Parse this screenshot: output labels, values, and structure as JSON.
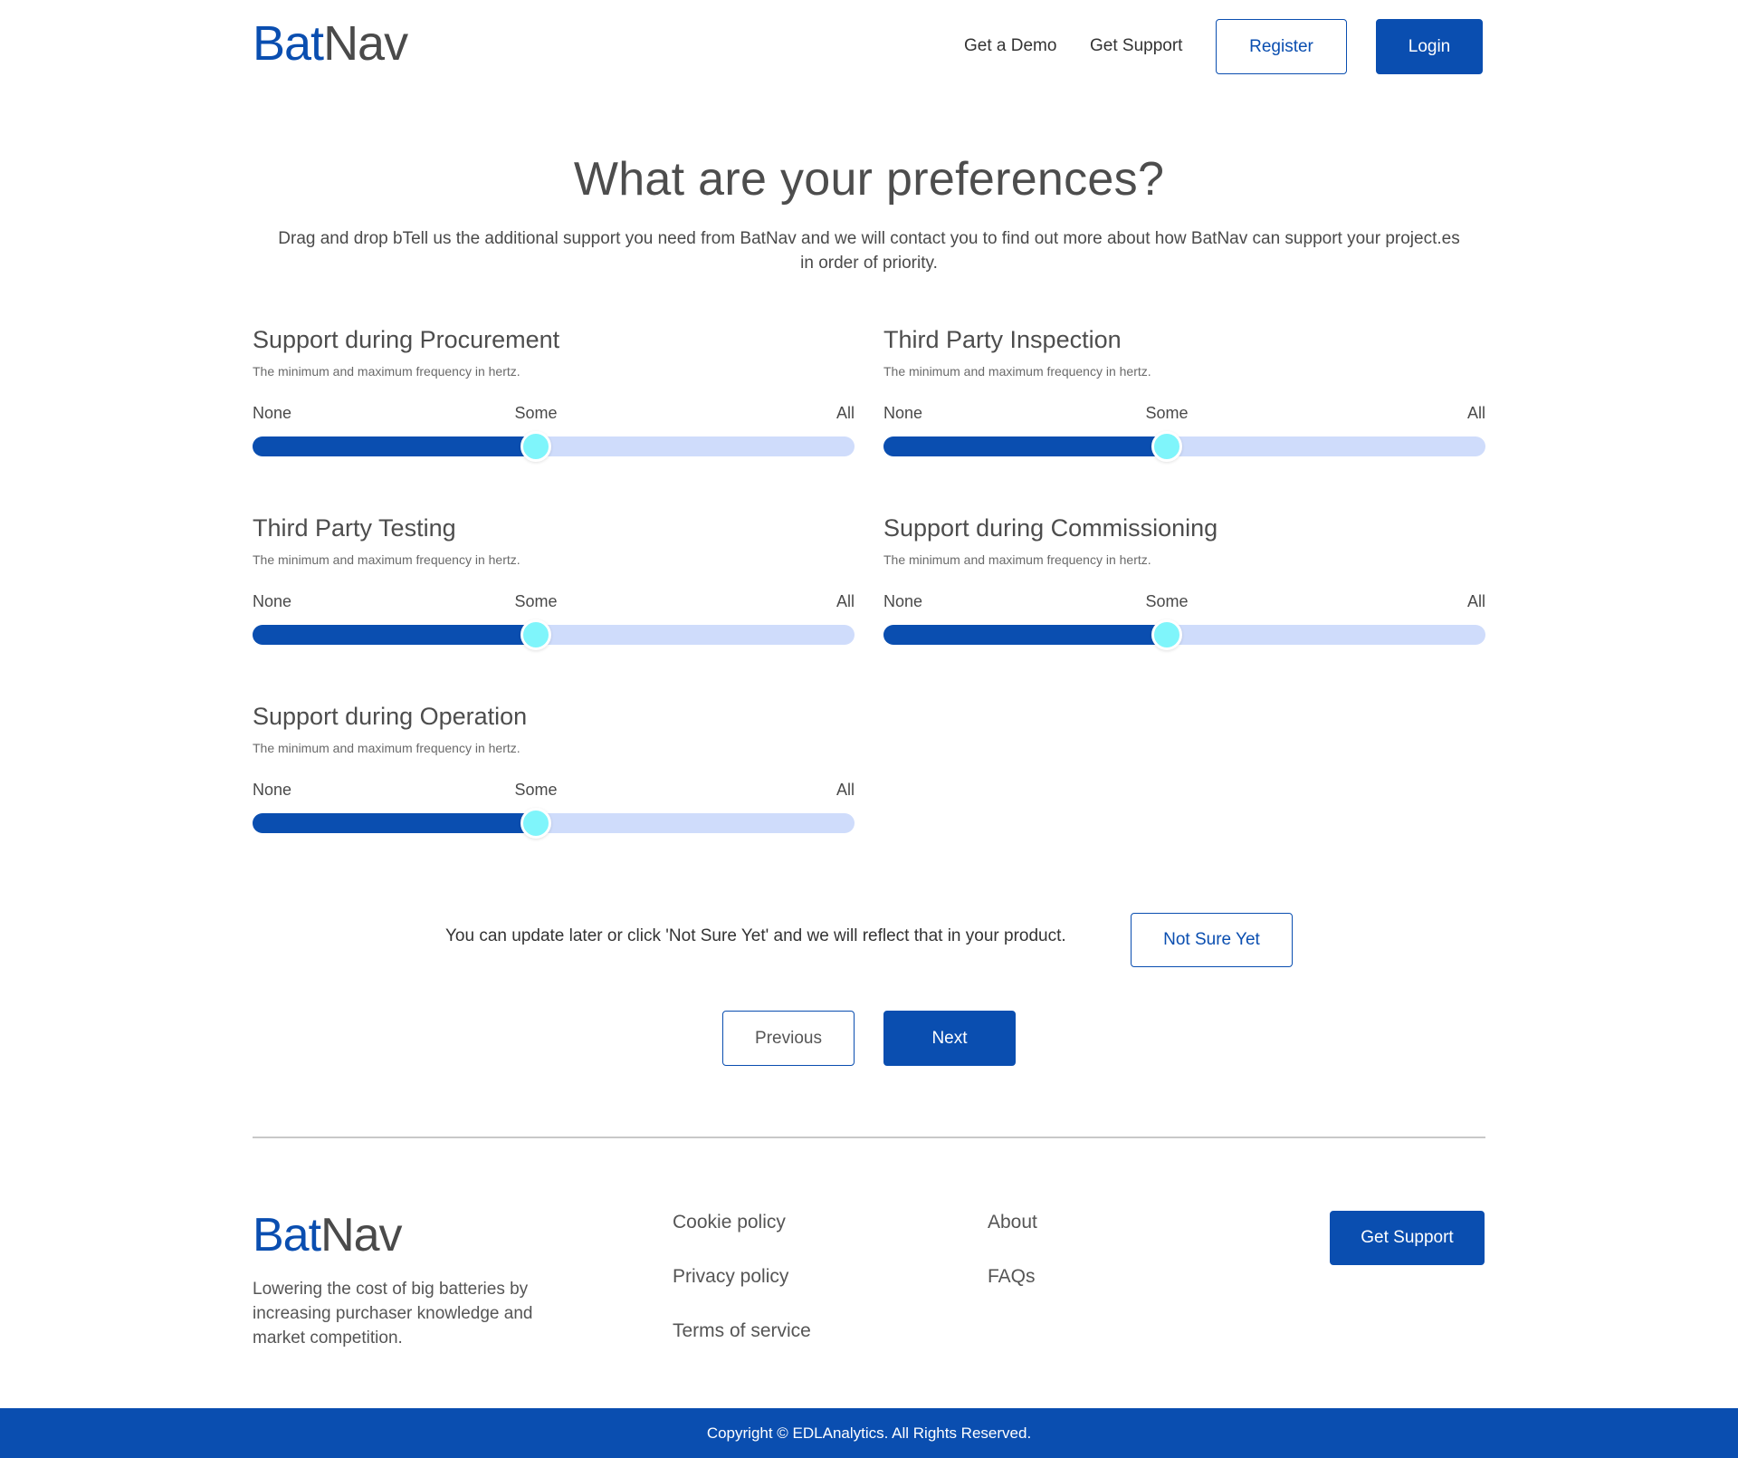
{
  "header": {
    "logo_part1": "Bat",
    "logo_part2": "Nav",
    "nav": [
      "Get a Demo",
      "Get Support"
    ],
    "register_label": "Register",
    "login_label": "Login"
  },
  "main": {
    "title": "What are your preferences?",
    "subtitle": "Drag and drop bTell us the additional support you need from BatNav and we will contact you to find out more about how BatNav can support your project.es in order of priority.",
    "sliders": [
      {
        "title": "Support during Procurement",
        "description": "The minimum and maximum frequency in hertz.",
        "labels": [
          "None",
          "Some",
          "All"
        ],
        "value": 0.47
      },
      {
        "title": "Third Party Inspection",
        "description": "The minimum and maximum frequency in hertz.",
        "labels": [
          "None",
          "Some",
          "All"
        ],
        "value": 0.47
      },
      {
        "title": "Third Party Testing",
        "description": "The minimum and maximum frequency in hertz.",
        "labels": [
          "None",
          "Some",
          "All"
        ],
        "value": 0.47
      },
      {
        "title": "Support during Commissioning",
        "description": "The minimum and maximum frequency in hertz.",
        "labels": [
          "None",
          "Some",
          "All"
        ],
        "value": 0.47
      },
      {
        "title": "Support during Operation",
        "description": "The minimum and maximum frequency in hertz.",
        "labels": [
          "None",
          "Some",
          "All"
        ],
        "value": 0.47
      }
    ],
    "not_sure_text": "You can update later or click 'Not Sure Yet' and we will reflect that in your product.",
    "not_sure_label": "Not Sure Yet",
    "previous_label": "Previous",
    "next_label": "Next"
  },
  "footer": {
    "logo_part1": "Bat",
    "logo_part2": "Nav",
    "tagline": "Lowering the cost of big batteries by increasing purchaser knowledge and market competition.",
    "links_col1": [
      "Cookie policy",
      "Privacy policy",
      "Terms of service"
    ],
    "links_col2": [
      "About",
      "FAQs"
    ],
    "get_support_label": "Get Support",
    "copyright": "Copyright © EDLAnalytics. All Rights Reserved."
  },
  "colors": {
    "brand": "#0a4eb0",
    "track": "#cfdcfb",
    "thumb": "#7ff5fb"
  }
}
